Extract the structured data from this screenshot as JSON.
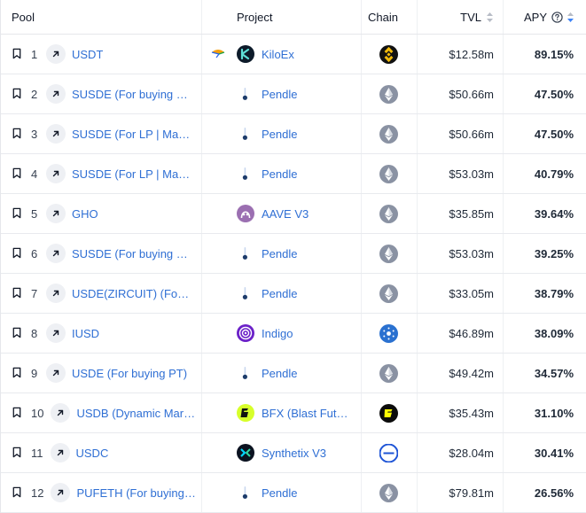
{
  "header": {
    "pool": "Pool",
    "project": "Project",
    "chain": "Chain",
    "tvl": "TVL",
    "apy": "APY"
  },
  "colors": {
    "link": "#2f6fd4",
    "ethereum": "#8a92a3",
    "binance": "#f0b90b",
    "cardano": "#2a71d0",
    "blast": "#fcfc03"
  },
  "rows": [
    {
      "rank": "1",
      "pool": "USDT",
      "project": "KiloEx",
      "project_icon": "kiloex-logo",
      "chain_icon": "binance-icon",
      "tvl": "$12.58m",
      "apy": "89.15%",
      "extra_icon": "airdrop-icon"
    },
    {
      "rank": "2",
      "pool": "SUSDE (For buying PT)",
      "project": "Pendle",
      "project_icon": "pendle-logo",
      "chain_icon": "ethereum-icon",
      "tvl": "$50.66m",
      "apy": "47.50%"
    },
    {
      "rank": "3",
      "pool": "SUSDE (For LP | Maturity)",
      "project": "Pendle",
      "project_icon": "pendle-logo",
      "chain_icon": "ethereum-icon",
      "tvl": "$50.66m",
      "apy": "47.50%"
    },
    {
      "rank": "4",
      "pool": "SUSDE (For LP | Maturity)",
      "project": "Pendle",
      "project_icon": "pendle-logo",
      "chain_icon": "ethereum-icon",
      "tvl": "$53.03m",
      "apy": "40.79%"
    },
    {
      "rank": "5",
      "pool": "GHO",
      "project": "AAVE V3",
      "project_icon": "aave-logo",
      "chain_icon": "ethereum-icon",
      "tvl": "$35.85m",
      "apy": "39.64%"
    },
    {
      "rank": "6",
      "pool": "SUSDE (For buying PT)",
      "project": "Pendle",
      "project_icon": "pendle-logo",
      "chain_icon": "ethereum-icon",
      "tvl": "$53.03m",
      "apy": "39.25%"
    },
    {
      "rank": "7",
      "pool": "USDE(ZIRCUIT) (For buying PT)",
      "project": "Pendle",
      "project_icon": "pendle-logo",
      "chain_icon": "ethereum-icon",
      "tvl": "$33.05m",
      "apy": "38.79%"
    },
    {
      "rank": "8",
      "pool": "IUSD",
      "project": "Indigo",
      "project_icon": "indigo-logo",
      "chain_icon": "cardano-icon",
      "tvl": "$46.89m",
      "apy": "38.09%"
    },
    {
      "rank": "9",
      "pool": "USDE (For buying PT)",
      "project": "Pendle",
      "project_icon": "pendle-logo",
      "chain_icon": "ethereum-icon",
      "tvl": "$49.42m",
      "apy": "34.57%"
    },
    {
      "rank": "10",
      "pool": "USDB (Dynamic Market)",
      "project": "BFX (Blast Futures)",
      "project_icon": "bfx-logo",
      "chain_icon": "blast-icon",
      "tvl": "$35.43m",
      "apy": "31.10%"
    },
    {
      "rank": "11",
      "pool": "USDC",
      "project": "Synthetix V3",
      "project_icon": "synthetix-logo",
      "chain_icon": "base-icon",
      "tvl": "$28.04m",
      "apy": "30.41%"
    },
    {
      "rank": "12",
      "pool": "PUFETH (For buying PT)",
      "project": "Pendle",
      "project_icon": "pendle-logo",
      "chain_icon": "ethereum-icon",
      "tvl": "$79.81m",
      "apy": "26.56%"
    }
  ]
}
